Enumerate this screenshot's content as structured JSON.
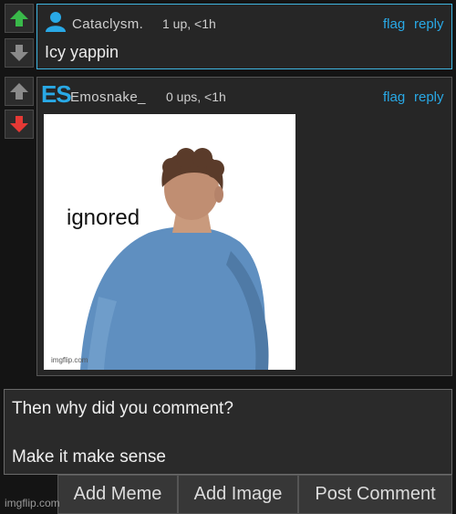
{
  "comment1": {
    "username": "Cataclysm.",
    "meta": "1 up, <1h",
    "flag_label": "flag",
    "reply_label": "reply",
    "text": "Icy yappin",
    "upvoted": true,
    "avatar_icon": "user-avatar-icon",
    "accent_color": "#3fb5e0"
  },
  "comment2": {
    "username": "Emosnake_",
    "meta": "0 ups, <1h",
    "flag_label": "flag",
    "reply_label": "reply",
    "avatar_text": "ES",
    "downvoted": true,
    "meme": {
      "caption": "ignored",
      "watermark": "imgflip.com"
    }
  },
  "reply_box": {
    "line1": "Then why did you comment?",
    "line2": "Make it make sense"
  },
  "actions": {
    "add_meme": "Add Meme",
    "add_image": "Add Image",
    "post_comment": "Post Comment"
  },
  "watermark": "imgflip.com",
  "colors": {
    "upvote": "#39b94a",
    "downvote": "#e53935",
    "link": "#29a9e6",
    "neutral_arrow": "#8a8a8a"
  }
}
